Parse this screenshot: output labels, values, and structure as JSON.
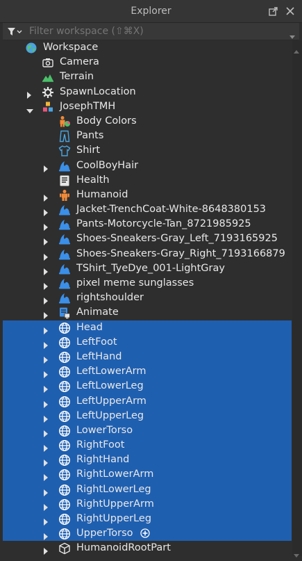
{
  "window": {
    "title": "Explorer"
  },
  "filter": {
    "placeholder": "Filter workspace (⇧⌘X)"
  },
  "colors": {
    "selection": "#1f5fb0",
    "mesh_icon": "#3b8fe8",
    "background": "#2e2e2e"
  },
  "tree": [
    {
      "label": "Workspace",
      "icon": "workspace-icon",
      "depth": 0,
      "arrow": "none",
      "selected": false
    },
    {
      "label": "Camera",
      "icon": "camera-icon",
      "depth": 1,
      "arrow": "none",
      "selected": false
    },
    {
      "label": "Terrain",
      "icon": "terrain-icon",
      "depth": 1,
      "arrow": "none",
      "selected": false
    },
    {
      "label": "SpawnLocation",
      "icon": "spawn-location-icon",
      "depth": 1,
      "arrow": "right",
      "selected": false
    },
    {
      "label": "JosephTMH",
      "icon": "model-icon",
      "depth": 1,
      "arrow": "down",
      "selected": false
    },
    {
      "label": "Body Colors",
      "icon": "body-colors-icon",
      "depth": 2,
      "arrow": "none",
      "selected": false
    },
    {
      "label": "Pants",
      "icon": "pants-icon",
      "depth": 2,
      "arrow": "none",
      "selected": false
    },
    {
      "label": "Shirt",
      "icon": "shirt-icon",
      "depth": 2,
      "arrow": "none",
      "selected": false
    },
    {
      "label": "CoolBoyHair",
      "icon": "accessory-icon",
      "depth": 2,
      "arrow": "right",
      "selected": false
    },
    {
      "label": "Health",
      "icon": "script-icon",
      "depth": 2,
      "arrow": "none",
      "selected": false
    },
    {
      "label": "Humanoid",
      "icon": "humanoid-icon",
      "depth": 2,
      "arrow": "right",
      "selected": false
    },
    {
      "label": "Jacket-TrenchCoat-White-8648380153",
      "icon": "accessory-icon",
      "depth": 2,
      "arrow": "right",
      "selected": false
    },
    {
      "label": "Pants-Motorcycle-Tan_8721985925",
      "icon": "accessory-icon",
      "depth": 2,
      "arrow": "right",
      "selected": false
    },
    {
      "label": "Shoes-Sneakers-Gray_Left_7193165925",
      "icon": "accessory-icon",
      "depth": 2,
      "arrow": "right",
      "selected": false
    },
    {
      "label": "Shoes-Sneakers-Gray_Right_7193166879",
      "icon": "accessory-icon",
      "depth": 2,
      "arrow": "right",
      "selected": false
    },
    {
      "label": "TShirt_TyeDye_001-LightGray",
      "icon": "accessory-icon",
      "depth": 2,
      "arrow": "right",
      "selected": false
    },
    {
      "label": "pixel meme sunglasses",
      "icon": "accessory-icon",
      "depth": 2,
      "arrow": "right",
      "selected": false
    },
    {
      "label": "rightshoulder",
      "icon": "accessory-icon",
      "depth": 2,
      "arrow": "right",
      "selected": false
    },
    {
      "label": "Animate",
      "icon": "local-script-icon",
      "depth": 2,
      "arrow": "right",
      "selected": false
    },
    {
      "label": "Head",
      "icon": "mesh-part-icon",
      "depth": 2,
      "arrow": "right",
      "selected": true
    },
    {
      "label": "LeftFoot",
      "icon": "mesh-part-icon",
      "depth": 2,
      "arrow": "right",
      "selected": true
    },
    {
      "label": "LeftHand",
      "icon": "mesh-part-icon",
      "depth": 2,
      "arrow": "right",
      "selected": true
    },
    {
      "label": "LeftLowerArm",
      "icon": "mesh-part-icon",
      "depth": 2,
      "arrow": "right",
      "selected": true
    },
    {
      "label": "LeftLowerLeg",
      "icon": "mesh-part-icon",
      "depth": 2,
      "arrow": "right",
      "selected": true
    },
    {
      "label": "LeftUpperArm",
      "icon": "mesh-part-icon",
      "depth": 2,
      "arrow": "right",
      "selected": true
    },
    {
      "label": "LeftUpperLeg",
      "icon": "mesh-part-icon",
      "depth": 2,
      "arrow": "right",
      "selected": true
    },
    {
      "label": "LowerTorso",
      "icon": "mesh-part-icon",
      "depth": 2,
      "arrow": "right",
      "selected": true
    },
    {
      "label": "RightFoot",
      "icon": "mesh-part-icon",
      "depth": 2,
      "arrow": "right",
      "selected": true
    },
    {
      "label": "RightHand",
      "icon": "mesh-part-icon",
      "depth": 2,
      "arrow": "right",
      "selected": true
    },
    {
      "label": "RightLowerArm",
      "icon": "mesh-part-icon",
      "depth": 2,
      "arrow": "right",
      "selected": true
    },
    {
      "label": "RightLowerLeg",
      "icon": "mesh-part-icon",
      "depth": 2,
      "arrow": "right",
      "selected": true
    },
    {
      "label": "RightUpperArm",
      "icon": "mesh-part-icon",
      "depth": 2,
      "arrow": "right",
      "selected": true
    },
    {
      "label": "RightUpperLeg",
      "icon": "mesh-part-icon",
      "depth": 2,
      "arrow": "right",
      "selected": true
    },
    {
      "label": "UpperTorso",
      "icon": "mesh-part-icon",
      "depth": 2,
      "arrow": "right",
      "selected": true,
      "extra": "add-object-icon"
    },
    {
      "label": "HumanoidRootPart",
      "icon": "part-icon",
      "depth": 2,
      "arrow": "right",
      "selected": false
    }
  ]
}
